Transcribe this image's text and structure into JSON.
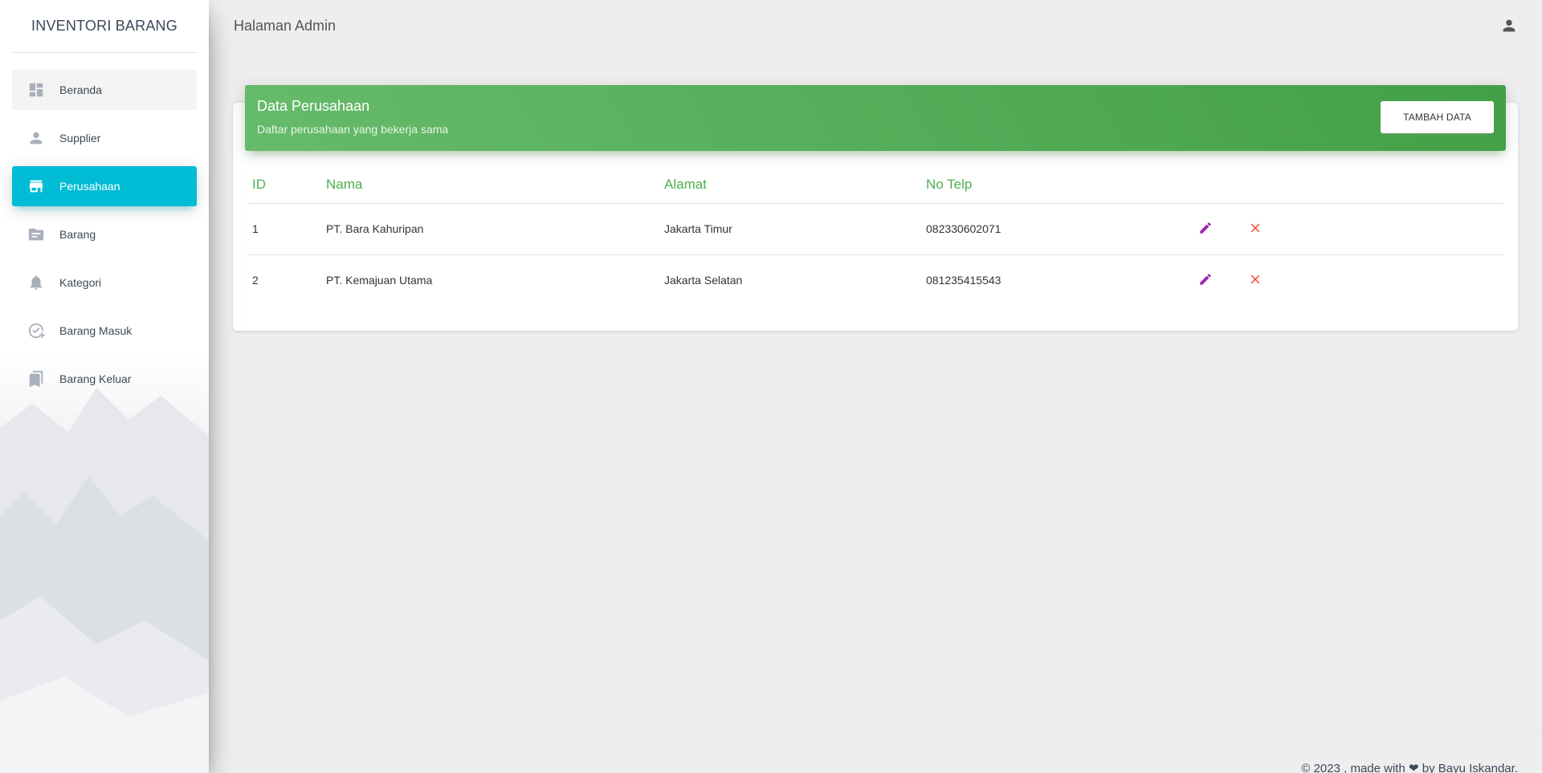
{
  "app": {
    "logo": "INVENTORI BARANG",
    "page_title": "Halaman Admin"
  },
  "sidebar": {
    "items": [
      {
        "label": "Beranda",
        "icon": "dashboard-icon",
        "state": "hover"
      },
      {
        "label": "Supplier",
        "icon": "person-icon",
        "state": "normal"
      },
      {
        "label": "Perusahaan",
        "icon": "store-icon",
        "state": "active"
      },
      {
        "label": "Barang",
        "icon": "folder-icon",
        "state": "normal"
      },
      {
        "label": "Kategori",
        "icon": "bell-icon",
        "state": "normal"
      },
      {
        "label": "Barang Masuk",
        "icon": "check-circle-plus-icon",
        "state": "normal"
      },
      {
        "label": "Barang Keluar",
        "icon": "bookmarks-icon",
        "state": "normal"
      }
    ]
  },
  "card": {
    "title": "Data Perusahaan",
    "subtitle": "Daftar perusahaan yang bekerja sama",
    "add_button": "TAMBAH DATA",
    "header_color": "#4caf50"
  },
  "table": {
    "columns": [
      "ID",
      "Nama",
      "Alamat",
      "No Telp"
    ],
    "rows": [
      {
        "id": "1",
        "nama": "PT. Bara Kahuripan",
        "alamat": "Jakarta Timur",
        "telp": "082330602071"
      },
      {
        "id": "2",
        "nama": "PT. Kemajuan Utama",
        "alamat": "Jakarta Selatan",
        "telp": "081235415543"
      }
    ],
    "edit_icon": "pencil-icon",
    "delete_icon": "close-icon",
    "edit_color": "#9c27b0",
    "delete_color": "#f44336"
  },
  "footer": {
    "prefix": "© 2023 , made with",
    "suffix": "by Bayu Iskandar."
  },
  "colors": {
    "accent": "#00bcd4",
    "success": "#4caf50"
  }
}
